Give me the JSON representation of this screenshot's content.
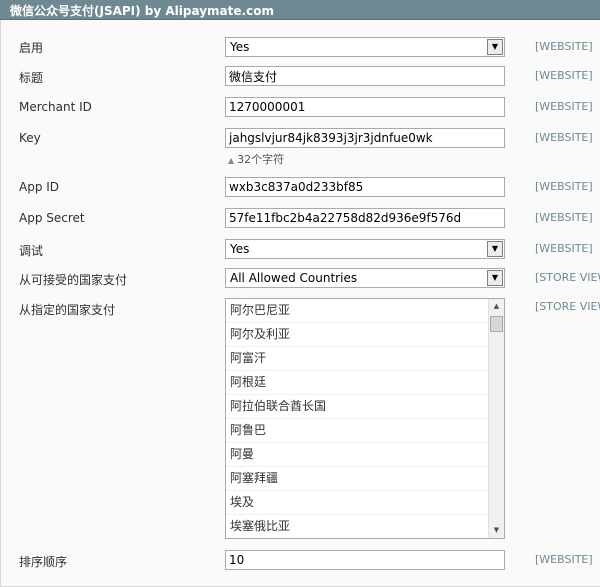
{
  "header": {
    "title": "微信公众号支付(JSAPI) by Alipaymate.com"
  },
  "fields": {
    "enabled": {
      "label": "启用",
      "value": "Yes",
      "scope": "[WEBSITE]"
    },
    "title": {
      "label": "标题",
      "value": "微信支付",
      "scope": "[WEBSITE]"
    },
    "merchant_id": {
      "label": "Merchant ID",
      "value": "1270000001",
      "scope": "[WEBSITE]"
    },
    "key": {
      "label": "Key",
      "value": "jahgslvjur84jk8393j3jr3jdnfue0wk",
      "scope": "[WEBSITE]",
      "hint": "32个字符"
    },
    "app_id": {
      "label": "App ID",
      "value": "wxb3c837a0d233bf85",
      "scope": "[WEBSITE]"
    },
    "app_secret": {
      "label": "App Secret",
      "value": "57fe11fbc2b4a22758d82d936e9f576d",
      "scope": "[WEBSITE]"
    },
    "debug": {
      "label": "调试",
      "value": "Yes",
      "scope": "[WEBSITE]"
    },
    "allowed_countries": {
      "label": "从可接受的国家支付",
      "value": "All Allowed Countries",
      "scope": "[STORE VIEW]"
    },
    "specific_countries": {
      "label": "从指定的国家支付",
      "scope": "[STORE VIEW]",
      "options": [
        "阿尔巴尼亚",
        "阿尔及利亚",
        "阿富汗",
        "阿根廷",
        "阿拉伯联合酋长国",
        "阿鲁巴",
        "阿曼",
        "阿塞拜疆",
        "埃及",
        "埃塞俄比亚"
      ]
    },
    "sort_order": {
      "label": "排序顺序",
      "value": "10",
      "scope": "[WEBSITE]"
    }
  },
  "icons": {
    "dropdown": "chevron-down-icon",
    "hint": "triangle-up-icon"
  },
  "colors": {
    "header_bg": "#6f8992",
    "scope_text": "#6f8992"
  }
}
